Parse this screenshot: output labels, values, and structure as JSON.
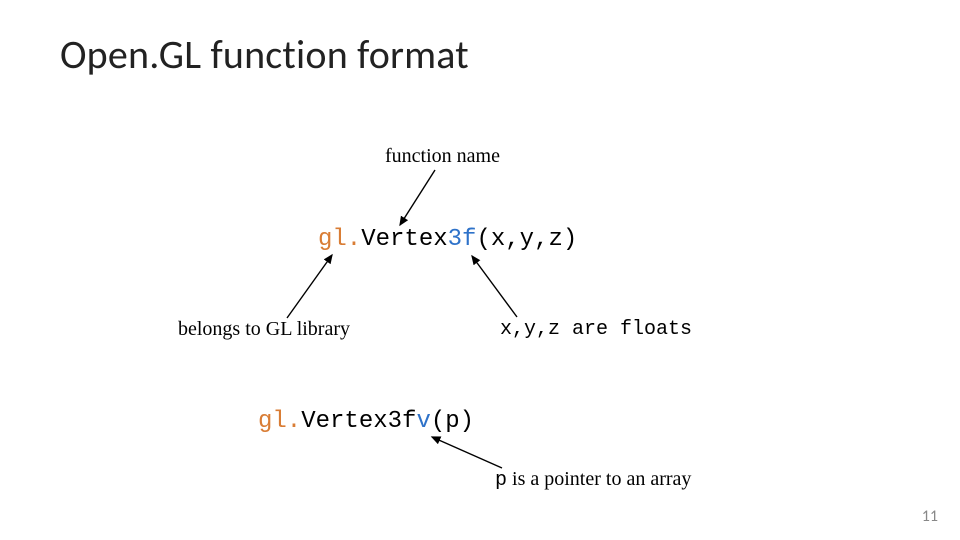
{
  "title": "Open.GL function format",
  "labels": {
    "function_name": "function name",
    "belongs_to": "belongs to GL library",
    "floats": "x,y,z are floats",
    "pointer_prefix": "p",
    "pointer_rest": " is a pointer to an array"
  },
  "code1": {
    "prefix_gl": "gl.",
    "name": "Vertex",
    "suffix": "3f",
    "args": "(x,y,z)"
  },
  "code2": {
    "prefix_gl": "gl.",
    "name": "Vertex",
    "suffix_num": "3f",
    "suffix_v": "v",
    "args": "(p)"
  },
  "page_number": "11",
  "colors": {
    "orange": "#d97d35",
    "blue": "#2e72c9"
  }
}
